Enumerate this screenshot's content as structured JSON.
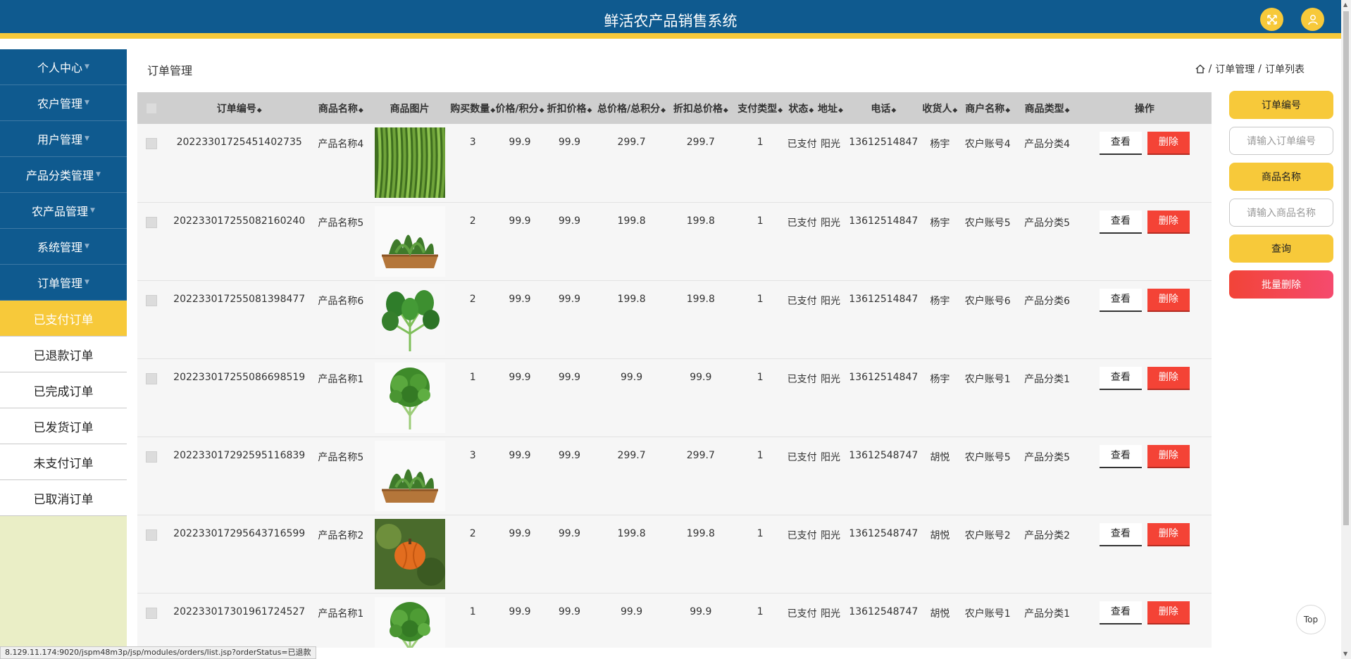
{
  "header": {
    "title": "鲜活农产品销售系统"
  },
  "sidebar": {
    "menus": [
      {
        "label": "个人中心"
      },
      {
        "label": "农户管理"
      },
      {
        "label": "用户管理"
      },
      {
        "label": "产品分类管理"
      },
      {
        "label": "农产品管理"
      },
      {
        "label": "系统管理"
      },
      {
        "label": "订单管理"
      }
    ],
    "submenus": [
      {
        "label": "已支付订单",
        "active": true
      },
      {
        "label": "已退款订单"
      },
      {
        "label": "已完成订单"
      },
      {
        "label": "已发货订单"
      },
      {
        "label": "未支付订单"
      },
      {
        "label": "已取消订单"
      }
    ]
  },
  "main": {
    "title": "订单管理",
    "breadcrumb": {
      "a": "订单管理",
      "sep": "/",
      "b": "订单列表"
    }
  },
  "table": {
    "headers": [
      "订单编号",
      "商品名称",
      "商品图片",
      "购买数量",
      "价格/积分",
      "折扣价格",
      "总价格/总积分",
      "折扣总价格",
      "支付类型",
      "状态",
      "地址",
      "电话",
      "收货人",
      "商户名称",
      "商品类型",
      "操作"
    ],
    "view_label": "查看",
    "delete_label": "删除",
    "rows": [
      {
        "order_no": "20223301725451402735",
        "name": "产品名称4",
        "img": "beans",
        "qty": "3",
        "price": "99.9",
        "disc": "99.9",
        "total": "299.7",
        "disc_total": "299.7",
        "pay": "1",
        "status": "已支付",
        "addr": "阳光",
        "phone": "13612514847",
        "receiver": "杨宇",
        "merchant": "农户账号4",
        "category": "产品分类4"
      },
      {
        "order_no": "20223301725508216024​0",
        "name": "产品名称5",
        "img": "basket",
        "qty": "2",
        "price": "99.9",
        "disc": "99.9",
        "total": "199.8",
        "disc_total": "199.8",
        "pay": "1",
        "status": "已支付",
        "addr": "阳光",
        "phone": "13612514847",
        "receiver": "杨宇",
        "merchant": "农户账号5",
        "category": "产品分类5"
      },
      {
        "order_no": "20223301725508139847​7",
        "name": "产品名称6",
        "img": "greens",
        "qty": "2",
        "price": "99.9",
        "disc": "99.9",
        "total": "199.8",
        "disc_total": "199.8",
        "pay": "1",
        "status": "已支付",
        "addr": "阳光",
        "phone": "13612514847",
        "receiver": "杨宇",
        "merchant": "农户账号6",
        "category": "产品分类6"
      },
      {
        "order_no": "20223301725508669851​9",
        "name": "产品名称1",
        "img": "parsley",
        "qty": "1",
        "price": "99.9",
        "disc": "99.9",
        "total": "99.9",
        "disc_total": "99.9",
        "pay": "1",
        "status": "已支付",
        "addr": "阳光",
        "phone": "13612514847",
        "receiver": "杨宇",
        "merchant": "农户账号1",
        "category": "产品分类1"
      },
      {
        "order_no": "20223301729259511683​9",
        "name": "产品名称5",
        "img": "basket",
        "qty": "3",
        "price": "99.9",
        "disc": "99.9",
        "total": "299.7",
        "disc_total": "299.7",
        "pay": "1",
        "status": "已支付",
        "addr": "阳光",
        "phone": "13612548747",
        "receiver": "胡悦",
        "merchant": "农户账号5",
        "category": "产品分类5"
      },
      {
        "order_no": "20223301729564371659​9",
        "name": "产品名称2",
        "img": "pumpkin",
        "qty": "2",
        "price": "99.9",
        "disc": "99.9",
        "total": "199.8",
        "disc_total": "199.8",
        "pay": "1",
        "status": "已支付",
        "addr": "阳光",
        "phone": "13612548747",
        "receiver": "胡悦",
        "merchant": "农户账号2",
        "category": "产品分类2"
      },
      {
        "order_no": "20223301730196172452​7",
        "name": "产品名称1",
        "img": "parsley",
        "qty": "1",
        "price": "99.9",
        "disc": "99.9",
        "total": "99.9",
        "disc_total": "99.9",
        "pay": "1",
        "status": "已支付",
        "addr": "阳光",
        "phone": "13612548747",
        "receiver": "胡悦",
        "merchant": "农户账号1",
        "category": "产品分类1"
      }
    ]
  },
  "search": {
    "order_no_label": "订单编号",
    "order_no_placeholder": "请输入订单编号",
    "product_name_label": "商品名称",
    "product_name_placeholder": "请输入商品名称",
    "query_label": "查询",
    "batch_delete_label": "批量删除"
  },
  "top_button": "Top",
  "status_url": "8.129.11.174:9020/jspm48m3p/jsp/modules/orders/list.jsp?orderStatus=已退款",
  "colors": {
    "primary": "#0f5a8f",
    "accent": "#f7c93a",
    "danger": "#f44336"
  }
}
